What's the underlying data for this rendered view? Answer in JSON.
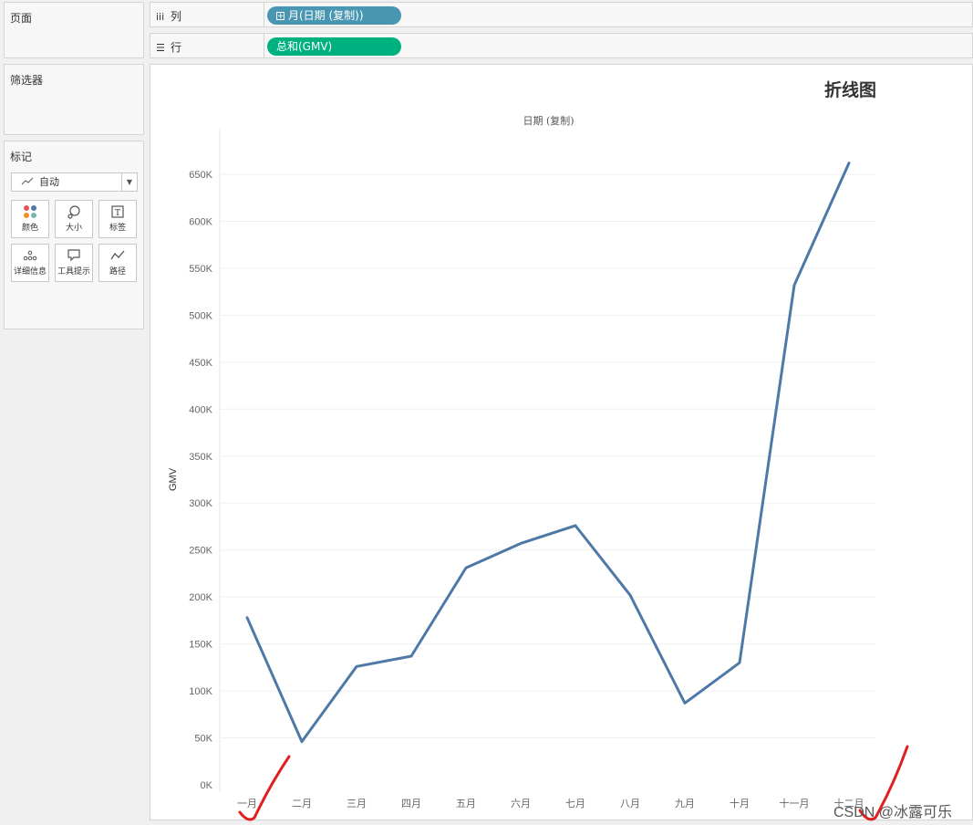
{
  "sidebar": {
    "pages_title": "页面",
    "filters_title": "筛选器",
    "marks_title": "标记",
    "marks_type": "自动",
    "mark_buttons": [
      {
        "label": "颜色",
        "icon": "color-dots-icon"
      },
      {
        "label": "大小",
        "icon": "size-icon"
      },
      {
        "label": "标签",
        "icon": "label-icon"
      },
      {
        "label": "详细信息",
        "icon": "detail-icon"
      },
      {
        "label": "工具提示",
        "icon": "tooltip-icon"
      },
      {
        "label": "路径",
        "icon": "path-icon"
      }
    ]
  },
  "shelves": {
    "columns_label": "列",
    "columns_pill": "月(日期 (复制))",
    "columns_color": "#4996b2",
    "rows_label": "行",
    "rows_pill": "总和(GMV)",
    "rows_color": "#00b180"
  },
  "view": {
    "title": "折线图",
    "x_header": "日期 (复制)",
    "watermark": "CSDN @冰露可乐"
  },
  "chart_data": {
    "type": "line",
    "title": "折线图",
    "xlabel": "日期 (复制)",
    "ylabel": "GMV",
    "categories": [
      "一月",
      "二月",
      "三月",
      "四月",
      "五月",
      "六月",
      "七月",
      "八月",
      "九月",
      "十月",
      "十一月",
      "十二月"
    ],
    "series": [
      {
        "values": [
          178000,
          46000,
          126000,
          137000,
          231000,
          257000,
          276000,
          202000,
          87000,
          130000,
          532000,
          662000
        ],
        "color": "#4e79a7"
      }
    ],
    "yticks": [
      0,
      50000,
      100000,
      150000,
      200000,
      250000,
      300000,
      350000,
      400000,
      450000,
      500000,
      550000,
      600000,
      650000
    ],
    "ytick_labels": [
      "0K",
      "50K",
      "100K",
      "150K",
      "200K",
      "250K",
      "300K",
      "350K",
      "400K",
      "450K",
      "500K",
      "550K",
      "600K",
      "650K"
    ],
    "ylim": [
      0,
      650000
    ],
    "grid": true,
    "legend": "none"
  }
}
